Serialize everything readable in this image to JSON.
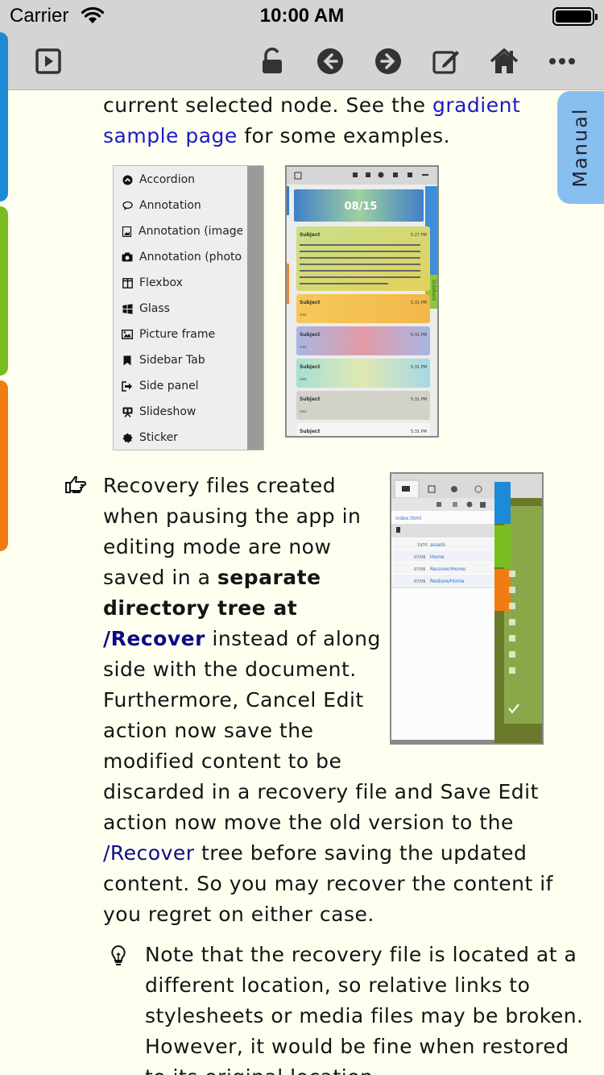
{
  "status_bar": {
    "carrier": "Carrier",
    "time": "10:00 AM"
  },
  "toolbar": {
    "buttons": [
      "play-icon",
      "unlock-icon",
      "back-arrow-icon",
      "forward-arrow-icon",
      "edit-icon",
      "home-icon",
      "more-icon"
    ]
  },
  "side_tabs": {
    "manual_label": "Manual",
    "colors": [
      "#1d8ad6",
      "#78be20",
      "#f07c12"
    ]
  },
  "intro": {
    "text1": "current selected node. See the ",
    "link": "gradient sample page",
    "text2": " for some examples."
  },
  "menu_items": [
    "Accordion",
    "Annotation",
    "Annotation (image",
    "Annotation (photo",
    "Flexbox",
    "Glass",
    "Picture frame",
    "Sidebar Tab",
    "Side panel",
    "Slideshow",
    "Sticker"
  ],
  "phone_preview": {
    "date": "08/15",
    "entries": [
      {
        "subject": "Subject",
        "time": "5:27 PM",
        "body": "Use the + action tab to create a new text entry. Use the action tab to capture a photo and create a new photo entry. Use the action tab to create an image entry. If there is a selection, new entry is inserted after the entry that contains the selection, otherwise new entry is inserted as the first entry."
      },
      {
        "subject": "Subject",
        "time": "5:31 PM",
        "body": "xxx"
      },
      {
        "subject": "Subject",
        "time": "5:31 PM",
        "body": "xxx"
      },
      {
        "subject": "Subject",
        "time": "5:31 PM",
        "body": "xxx"
      },
      {
        "subject": "Subject",
        "time": "5:31 PM",
        "body": "xxx"
      },
      {
        "subject": "Subject",
        "time": "5:31 PM",
        "body": ""
      }
    ],
    "side_label": "Sidebars"
  },
  "file_preview": {
    "path": "index.html",
    "rows": [
      {
        "date": "1970",
        "name": "assets"
      },
      {
        "date": "07/06",
        "name": "Home"
      },
      {
        "date": "07/06",
        "name": "Recover/Home"
      },
      {
        "date": "07/06",
        "name": "Restore/Home"
      }
    ]
  },
  "recovery": {
    "line1": "Recovery files created",
    "line2": "when pausing the app in",
    "line3": "editing mode are now",
    "line4a": "saved in a ",
    "line4b": "separate",
    "line5": "directory tree at",
    "line6a": "/Recover",
    "line6b": " instead of along",
    "line7": "side with the document.",
    "line8": "Furthermore, Cancel Edit",
    "line9": "action now save the",
    "line10": "modified content to be",
    "line11": "discarded in a recovery file and Save Edit",
    "line12": "action now move the old version to the",
    "line13a": "/Recover",
    "line13b": " tree before saving the updated",
    "line14": "content. So you may recover the content if",
    "line15": "you regret on either case."
  },
  "note": {
    "line1": "Note that the recovery file is located at a",
    "line2": "different location, so relative links to",
    "line3": "stylesheets or media files may be broken.",
    "line4": "However, it would be fine when restored",
    "line5": "to its original location."
  }
}
